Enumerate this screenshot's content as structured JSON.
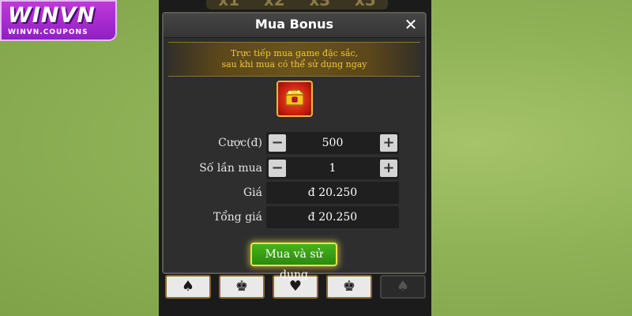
{
  "logo": {
    "brand": "WINVN",
    "domain": "WINVN.COUPONS"
  },
  "game": {
    "multipliers": [
      "x1",
      "x2",
      "x3",
      "x5"
    ],
    "cards": [
      "♠",
      "♚",
      "♥",
      "♚",
      "♠"
    ]
  },
  "modal": {
    "title": "Mua Bonus",
    "close_icon": "close-icon",
    "banner": {
      "line1": "Trực tiếp mua game đặc sắc,",
      "line2": "sau khi mua có thể sử dụng ngay"
    },
    "bonus_icon": "treasure-chest-icon",
    "bet": {
      "label": "Cược(đ)",
      "value": "500"
    },
    "count": {
      "label": "Số lần mua",
      "value": "1"
    },
    "price": {
      "label": "Giá",
      "value": "đ 20.250"
    },
    "total": {
      "label": "Tổng giá",
      "value": "đ 20.250"
    },
    "buy_button": "Mua và sử dụng"
  },
  "colors": {
    "background": "#8fb257",
    "banner_text": "#f2c73c",
    "button_green": "#3aa016",
    "button_glow": "#f0e24a",
    "logo_purple": "#b032d6"
  }
}
